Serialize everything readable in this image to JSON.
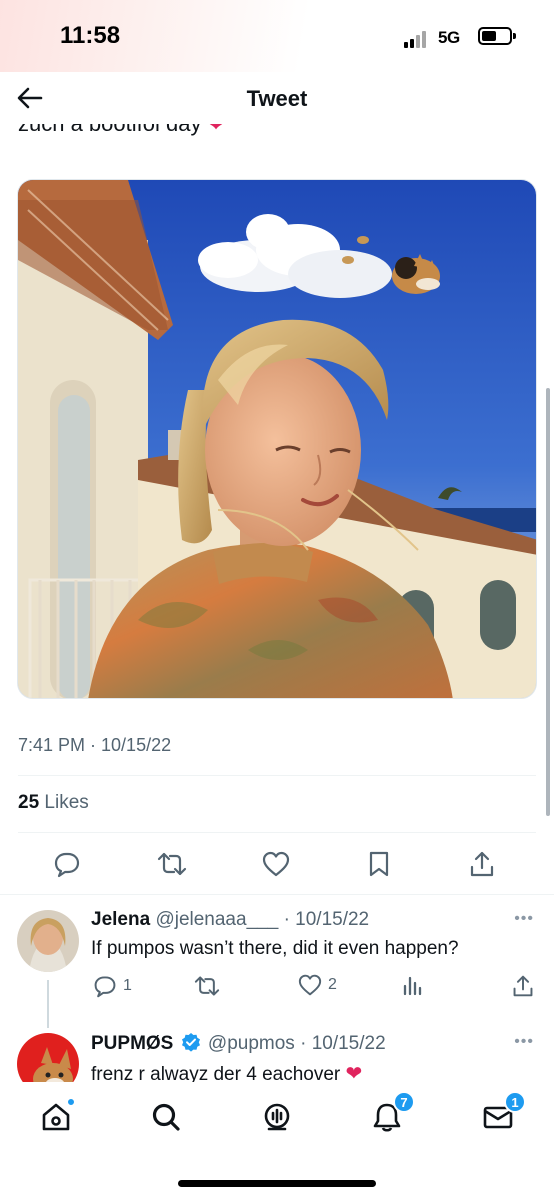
{
  "status_bar": {
    "time": "11:58",
    "network": "5G"
  },
  "header": {
    "title": "Tweet"
  },
  "tweet": {
    "text": "zuch a bootifol day",
    "timestamp": "7:41 PM · 10/15/22",
    "likes_count": "25",
    "likes_label": "Likes"
  },
  "replies": [
    {
      "name": "Jelena",
      "handle": "@jelenaaa___",
      "date": "· 10/15/22",
      "text": "If pumpos wasn’t there, did it even happen?",
      "reply_count": "1",
      "like_count": "2"
    },
    {
      "name": "PUPMØS",
      "verified": true,
      "handle": "@pupmos",
      "date": "· 10/15/22",
      "text": "frenz r alwayz der 4 eachover"
    }
  ],
  "tabbar": {
    "notifications_badge": "7",
    "messages_badge": "1"
  },
  "colors": {
    "accent": "#1d9bf0",
    "heart": "#e0245e",
    "muted": "#536471"
  },
  "icons": {
    "back": "arrow-left-icon",
    "reply": "comment-icon",
    "retweet": "retweet-icon",
    "like": "heart-icon",
    "bookmark": "bookmark-icon",
    "share": "share-icon",
    "analytics": "analytics-icon",
    "more": "more-icon",
    "home": "home-icon",
    "search": "search-icon",
    "spaces": "spaces-icon",
    "notifications": "bell-icon",
    "messages": "mail-icon"
  }
}
